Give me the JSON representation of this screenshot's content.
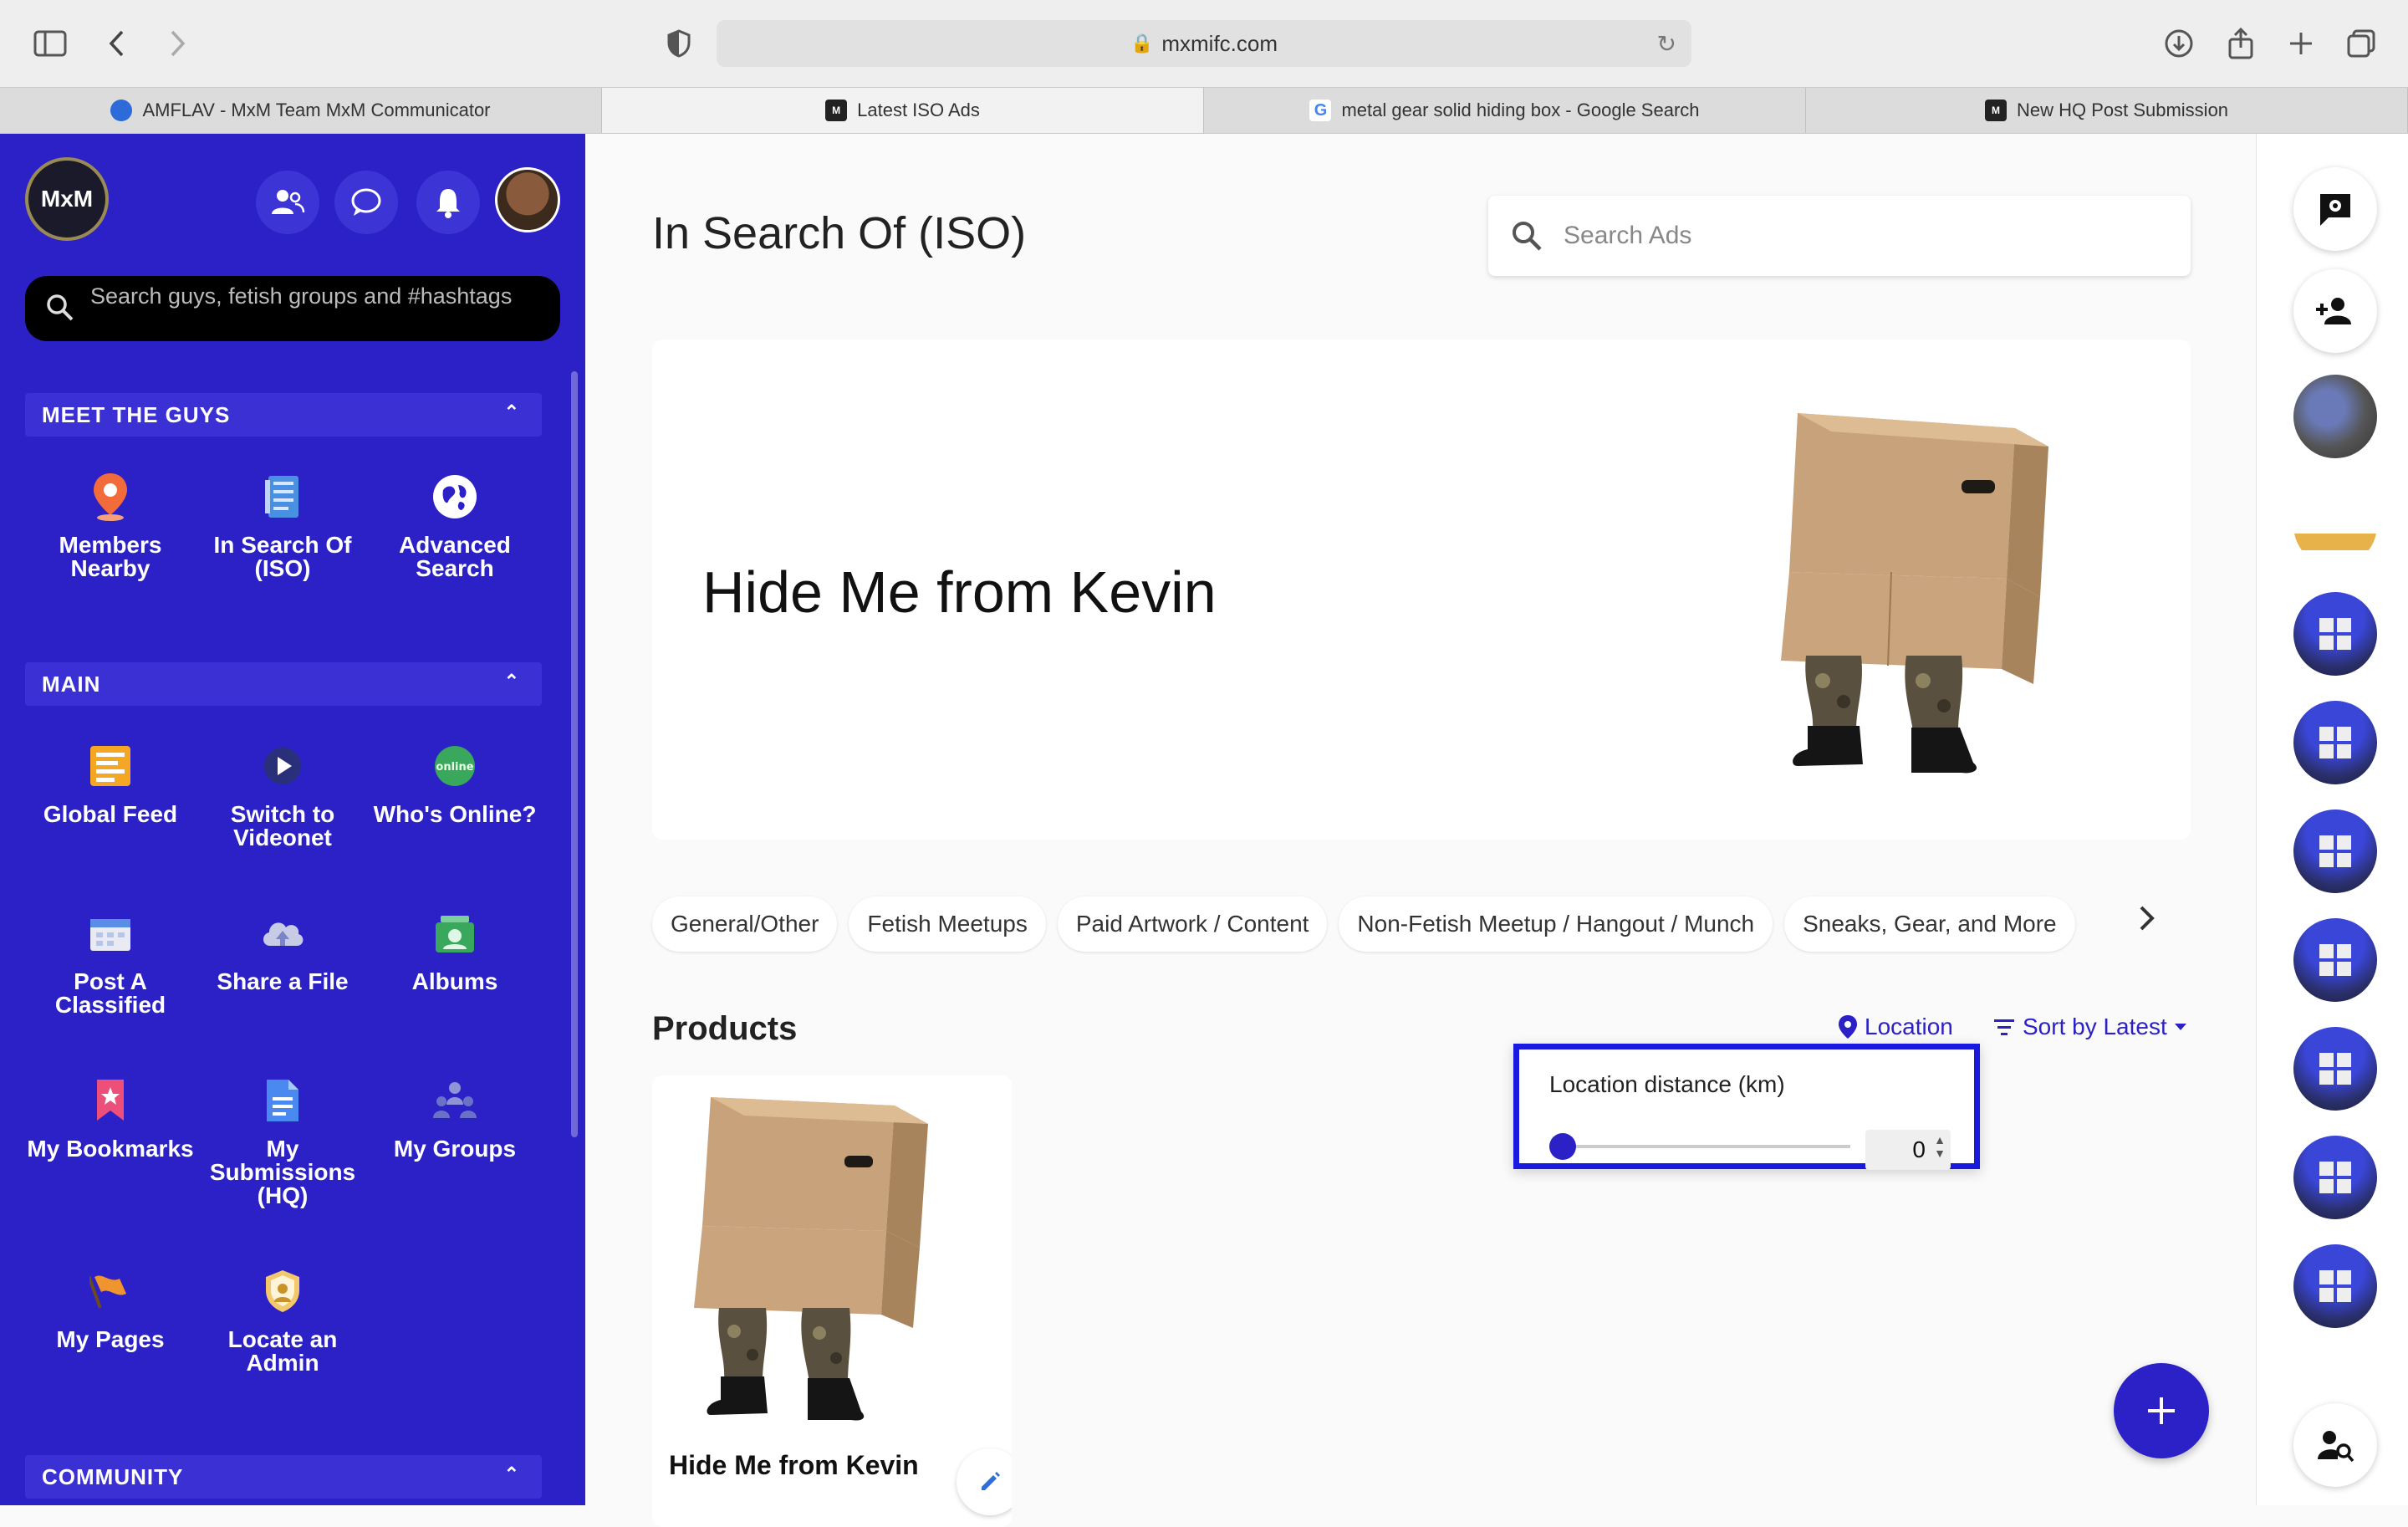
{
  "browser": {
    "url": "mxmifc.com",
    "tabs": [
      {
        "title": "AMFLAV - MxM Team MxM Communicator",
        "favicon": "blue-circle-icon",
        "active": false
      },
      {
        "title": "Latest ISO Ads",
        "favicon": "mxm-icon",
        "active": true
      },
      {
        "title": "metal gear solid hiding box - Google Search",
        "favicon": "google-icon",
        "active": false
      },
      {
        "title": "New HQ Post Submission",
        "favicon": "mxm-icon",
        "active": false
      }
    ]
  },
  "sidebar": {
    "logo_text": "MxM",
    "search_placeholder": "Search guys, fetish groups and #hashtags",
    "sections": {
      "meet": "MEET THE GUYS",
      "main": "MAIN",
      "community": "COMMUNITY"
    },
    "meet_items": [
      {
        "label": "Members Nearby",
        "icon": "map-pin-icon"
      },
      {
        "label": "In Search Of (ISO)",
        "icon": "notebook-icon"
      },
      {
        "label": "Advanced Search",
        "icon": "globe-icon"
      }
    ],
    "main_items": [
      {
        "label": "Global Feed",
        "icon": "feed-icon"
      },
      {
        "label": "Switch to Videonet",
        "icon": "video-icon"
      },
      {
        "label": "Who's Online?",
        "icon": "online-icon"
      },
      {
        "label": "Post A Classified",
        "icon": "calendar-icon"
      },
      {
        "label": "Share a File",
        "icon": "cloud-upload-icon"
      },
      {
        "label": "Albums",
        "icon": "album-icon"
      },
      {
        "label": "My Bookmarks",
        "icon": "bookmark-icon"
      },
      {
        "label": "My Submissions (HQ)",
        "icon": "document-icon"
      },
      {
        "label": "My Groups",
        "icon": "group-icon"
      },
      {
        "label": "My Pages",
        "icon": "flag-icon"
      },
      {
        "label": "Locate an Admin",
        "icon": "admin-badge-icon"
      }
    ]
  },
  "main": {
    "title": "In Search Of (ISO)",
    "search_placeholder": "Search Ads",
    "hero_title": "Hide Me from Kevin",
    "categories": [
      "General/Other",
      "Fetish Meetups",
      "Paid Artwork / Content",
      "Non-Fetish Meetup / Hangout / Munch",
      "Sneaks, Gear, and More"
    ],
    "products_heading": "Products",
    "location_label": "Location",
    "sort_label": "Sort by Latest",
    "location_popup": {
      "label": "Location distance (km)",
      "value": "0",
      "slider_fraction": 0
    },
    "product_card": {
      "title": "Hide Me from Kevin"
    }
  },
  "colors": {
    "brand": "#2b21c7",
    "highlight": "#1a19df"
  }
}
